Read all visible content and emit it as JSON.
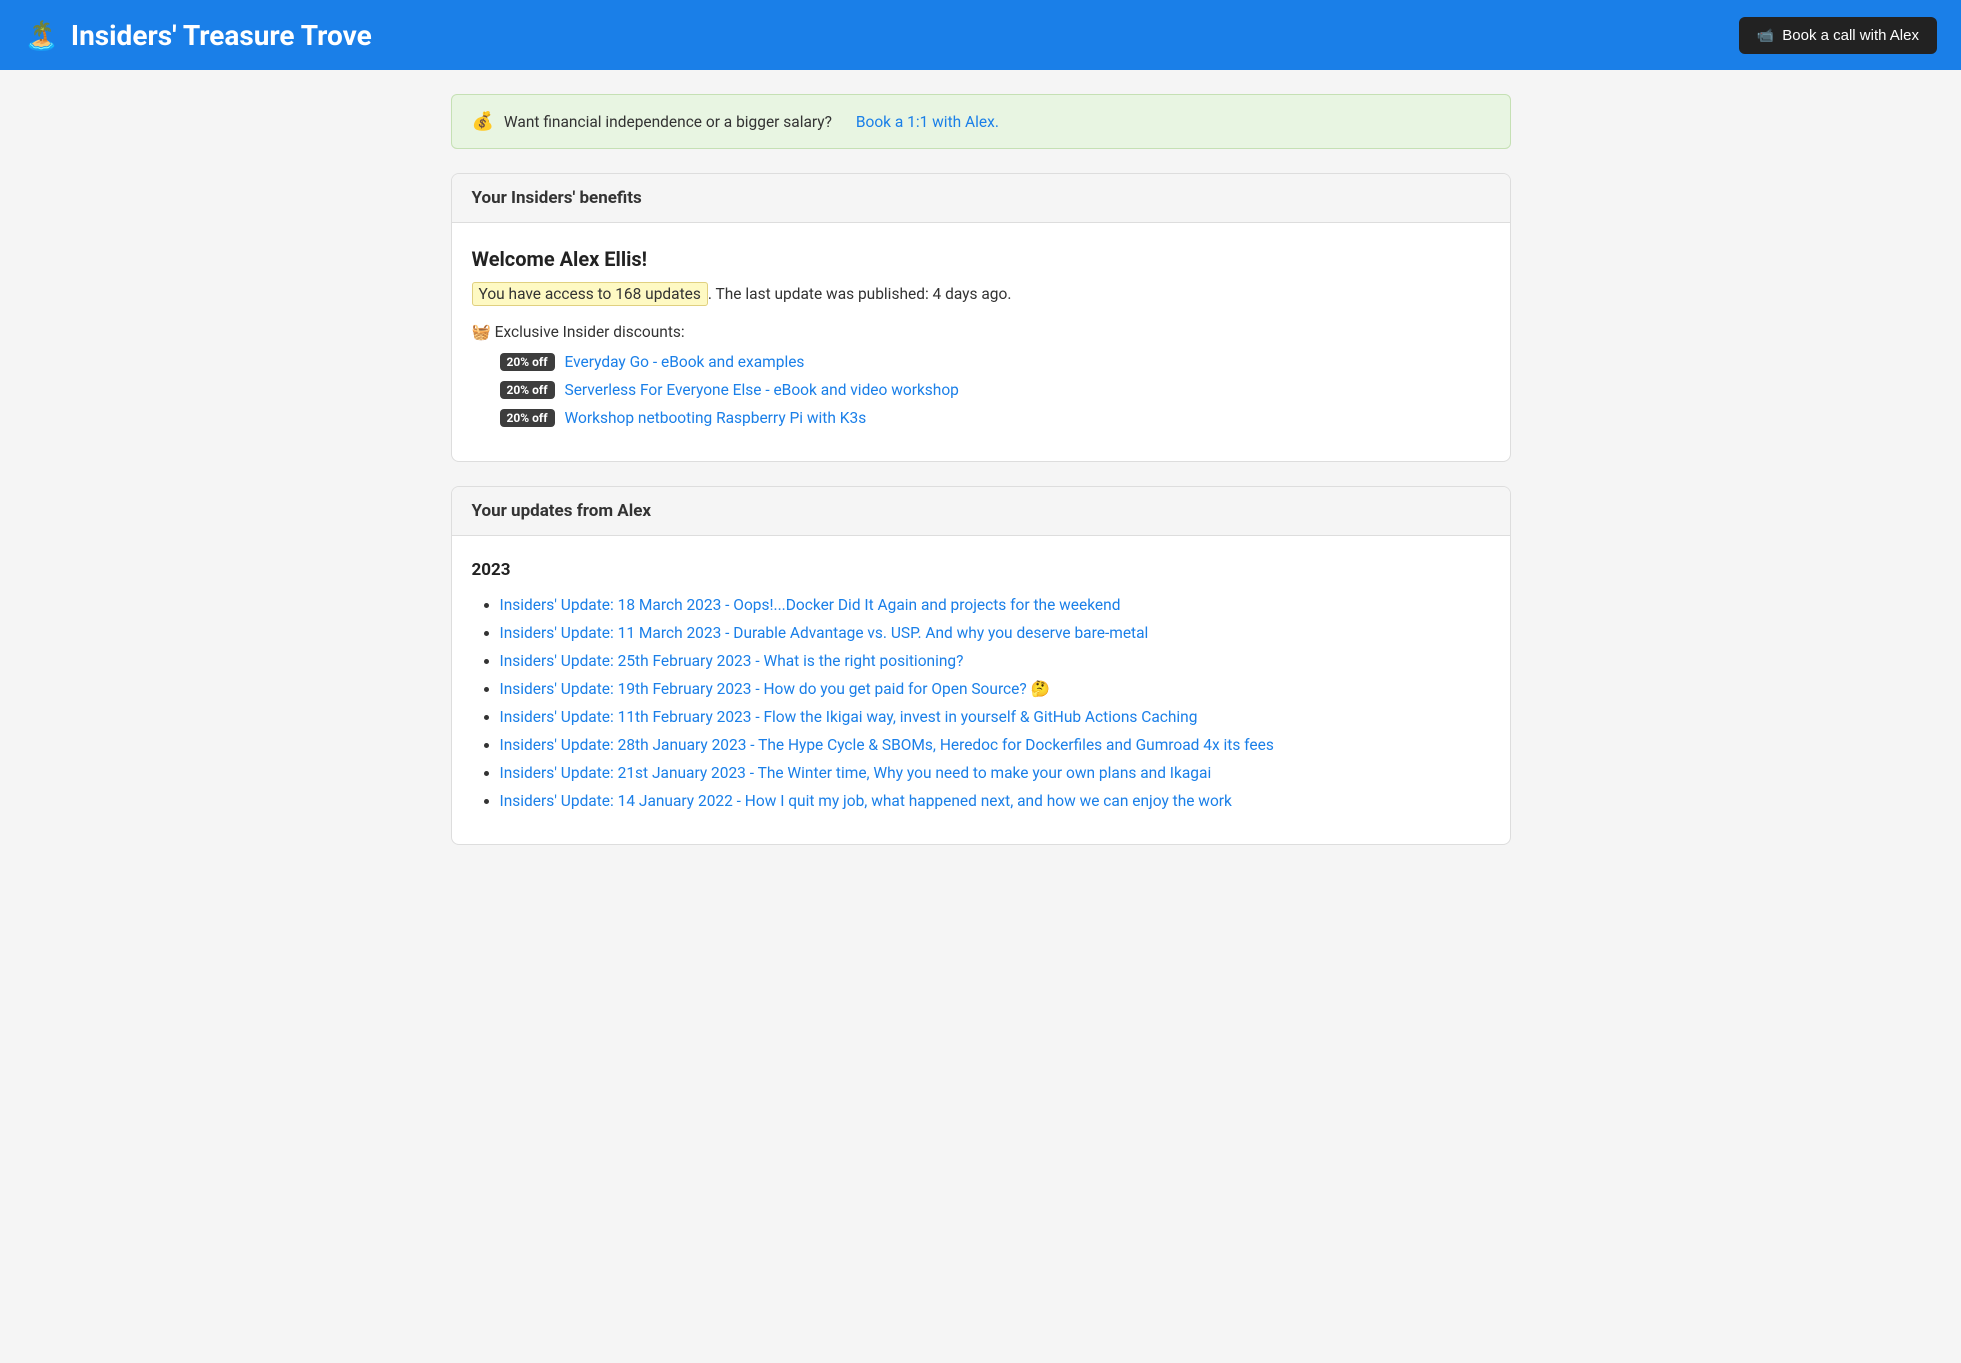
{
  "header": {
    "logo": "🏝️",
    "title": "Insiders' Treasure Trove",
    "book_call_label": "Book a call with Alex",
    "video_icon": "📹"
  },
  "banner": {
    "icon": "💰",
    "text": "Want financial independence or a bigger salary?",
    "link_text": "Book a 1:1 with Alex.",
    "link_href": "#"
  },
  "benefits_card": {
    "header": "Your Insiders' benefits",
    "welcome_title": "Welcome Alex Ellis!",
    "access_text_before": "You have access to 168 updates",
    "access_text_after": ". The last update was published: 4 days ago.",
    "discounts_label": "🧺 Exclusive Insider discounts:",
    "discounts": [
      {
        "badge": "20% off",
        "label": "Everyday Go - eBook and examples",
        "href": "#"
      },
      {
        "badge": "20% off",
        "label": "Serverless For Everyone Else - eBook and video workshop",
        "href": "#"
      },
      {
        "badge": "20% off",
        "label": "Workshop netbooting Raspberry Pi with K3s",
        "href": "#"
      }
    ]
  },
  "updates_card": {
    "header": "Your updates from Alex",
    "year": "2023",
    "updates": [
      {
        "label": "Insiders' Update: 18 March 2023 - Oops!...Docker Did It Again and projects for the weekend",
        "href": "#"
      },
      {
        "label": "Insiders' Update: 11 March 2023 - Durable Advantage vs. USP. And why you deserve bare-metal",
        "href": "#"
      },
      {
        "label": "Insiders' Update: 25th February 2023 - What is the right positioning?",
        "href": "#"
      },
      {
        "label": "Insiders' Update: 19th February 2023 - How do you get paid for Open Source? 🤔",
        "href": "#"
      },
      {
        "label": "Insiders' Update: 11th February 2023 - Flow the Ikigai way, invest in yourself & GitHub Actions Caching",
        "href": "#"
      },
      {
        "label": "Insiders' Update: 28th January 2023 - The Hype Cycle & SBOMs, Heredoc for Dockerfiles and Gumroad 4x its fees",
        "href": "#"
      },
      {
        "label": "Insiders' Update: 21st January 2023 - The Winter time, Why you need to make your own plans and Ikagai",
        "href": "#"
      },
      {
        "label": "Insiders' Update: 14 January 2022 - How I quit my job, what happened next, and how we can enjoy the work",
        "href": "#"
      }
    ]
  }
}
